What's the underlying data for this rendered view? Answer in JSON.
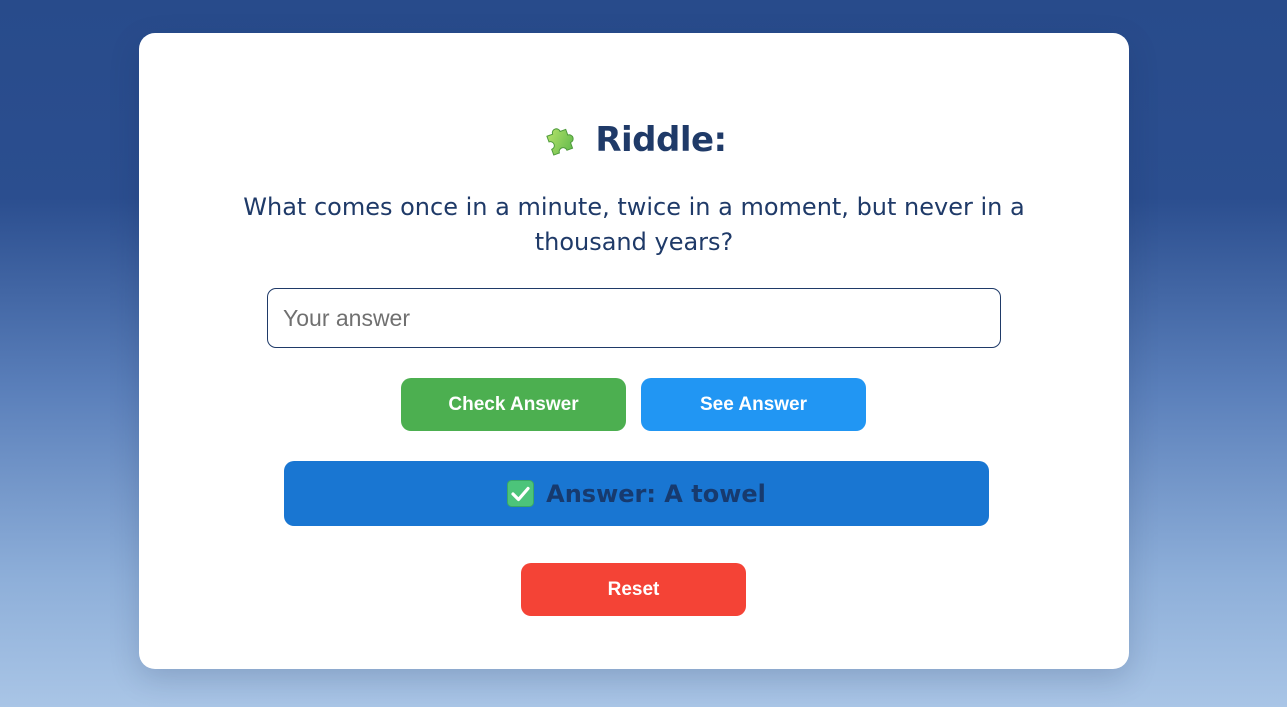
{
  "riddle": {
    "title": "Riddle:",
    "title_icon": "puzzle-piece-icon",
    "question": "What comes once in a minute, twice in a moment, but never in a thousand years?"
  },
  "answer_input": {
    "value": "",
    "placeholder": "Your answer"
  },
  "buttons": {
    "check_label": "Check Answer",
    "see_label": "See Answer",
    "reset_label": "Reset"
  },
  "result": {
    "icon": "check-mark-icon",
    "text": "Answer: A towel"
  },
  "colors": {
    "check_button": "#4caf50",
    "see_button": "#2196f3",
    "reset_button": "#f44336",
    "result_box": "#1976d2",
    "heading_text": "#1f3a68"
  }
}
